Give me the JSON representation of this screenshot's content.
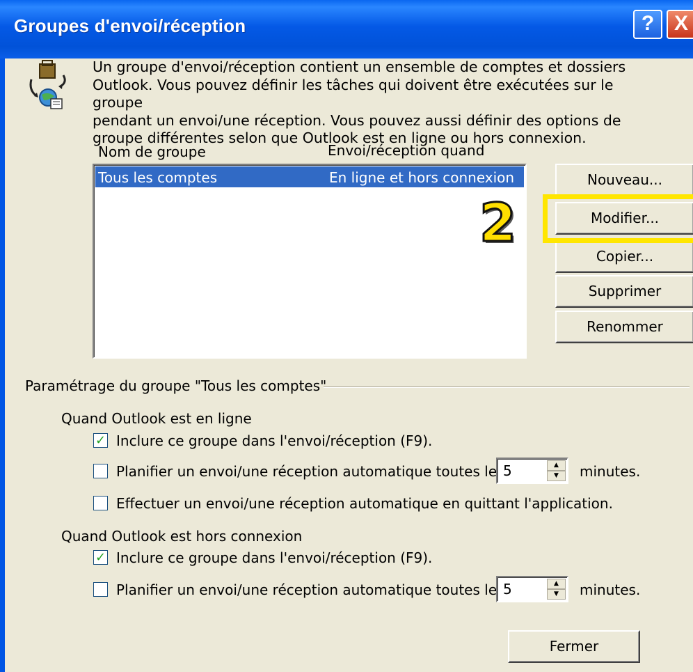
{
  "dialog": {
    "title": "Groupes d'envoi/réception",
    "help_symbol": "?",
    "close_symbol": "X"
  },
  "intro_text": "Un groupe d'envoi/réception contient un ensemble de comptes et dossiers\nOutlook. Vous pouvez définir les tâches qui doivent être exécutées sur le groupe\npendant un envoi/une réception. Vous pouvez aussi définir des options de\ngroupe différentes selon que Outlook est en ligne ou hors connexion.",
  "list": {
    "col_group_name": "Nom de groupe",
    "col_send_receive_when": "Envoi/réception quand",
    "rows": [
      {
        "name": "Tous les comptes",
        "when": "En ligne et hors connexion",
        "selected": true
      }
    ]
  },
  "buttons": {
    "new": "Nouveau...",
    "modify": "Modifier...",
    "copy": "Copier...",
    "delete": "Supprimer",
    "rename": "Renommer",
    "close": "Fermer"
  },
  "annotation": {
    "step_number": "2",
    "color": "#ffe600"
  },
  "settings": {
    "group_title": "Paramétrage du groupe \"Tous les comptes\"",
    "online": {
      "title": "Quand Outlook est en ligne",
      "include": {
        "label": "Inclure ce groupe dans l'envoi/réception (F9).",
        "checked": true
      },
      "schedule": {
        "label": "Planifier un envoi/une réception automatique toutes les",
        "checked": false,
        "value": "5",
        "unit": "minutes."
      },
      "on_exit": {
        "label": "Effectuer un envoi/une réception automatique en quittant l'application.",
        "checked": false
      }
    },
    "offline": {
      "title": "Quand Outlook est hors connexion",
      "include": {
        "label": "Inclure ce groupe dans l'envoi/réception (F9).",
        "checked": true
      },
      "schedule": {
        "label": "Planifier un envoi/une réception automatique toutes les",
        "checked": false,
        "value": "5",
        "unit": "minutes."
      }
    }
  },
  "icons": {
    "check": "✓",
    "spin_up": "▲",
    "spin_down": "▼"
  }
}
